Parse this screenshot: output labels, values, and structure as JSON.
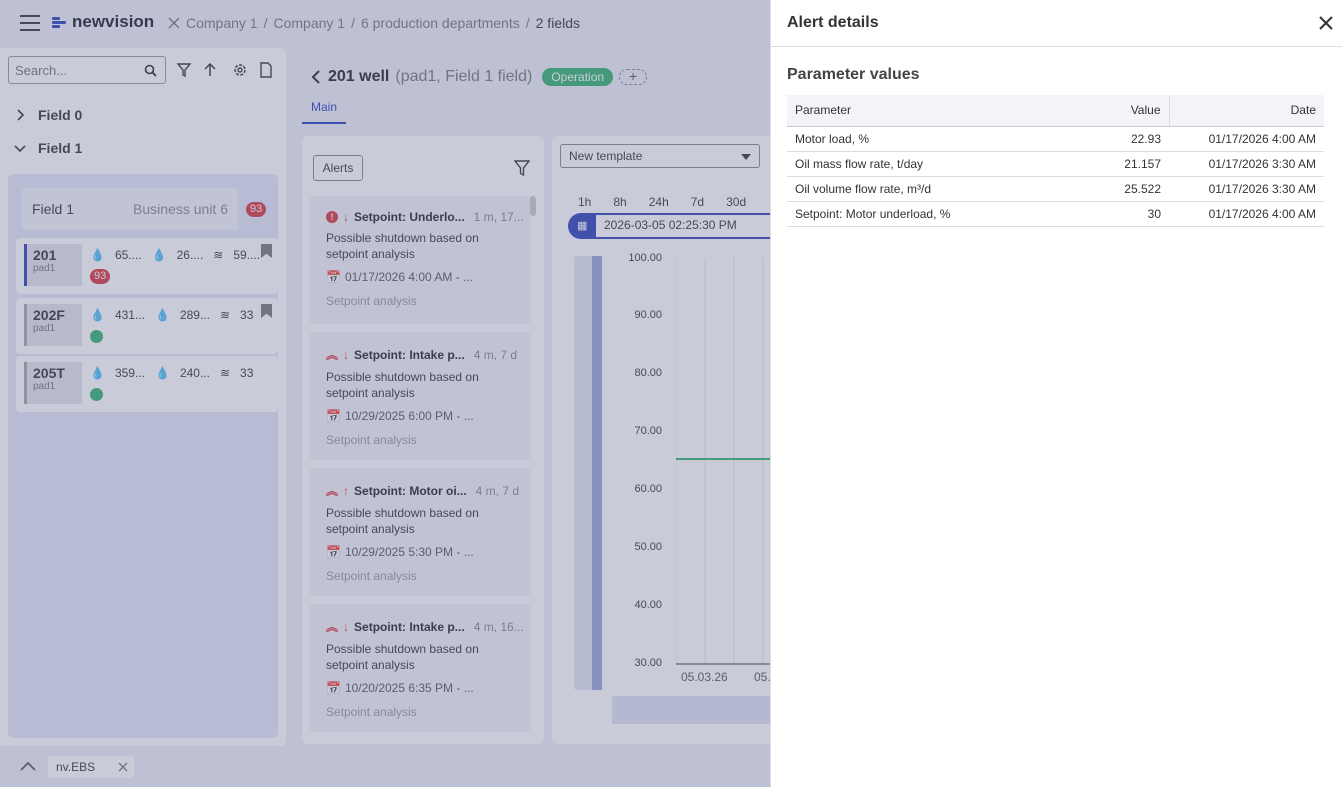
{
  "topbar": {
    "brand": "newvision",
    "breadcrumbs": [
      "Company 1",
      "/",
      "Company 1",
      "/",
      "6 production departments",
      "/",
      "2 fields"
    ]
  },
  "sidebar": {
    "search_placeholder": "Search...",
    "tree": [
      {
        "label": "Field 0",
        "expanded": false
      },
      {
        "label": "Field 1",
        "expanded": true
      }
    ],
    "field_card": {
      "name": "Field 1",
      "business_unit": "Business unit 6",
      "badge": "93"
    },
    "wells": [
      {
        "id": "201",
        "pad": "pad1",
        "v1": "65....",
        "v2": "26....",
        "v3": "59....",
        "badge": "93"
      },
      {
        "id": "202F",
        "pad": "pad1",
        "v1": "431...",
        "v2": "289...",
        "v3": "33"
      },
      {
        "id": "205T",
        "pad": "pad1",
        "v1": "359...",
        "v2": "240...",
        "v3": "33"
      }
    ]
  },
  "main": {
    "title": "201 well",
    "subtitle": "(pad1, Field 1 field)",
    "status": "Operation",
    "tab": "Main"
  },
  "alerts": {
    "button": "Alerts",
    "cards": [
      {
        "title": "Setpoint: Underlo...",
        "time": "1 m, 17...",
        "desc": "Possible shutdown based on setpoint analysis",
        "date": "01/17/2026 4:00 AM - ...",
        "source": "Setpoint analysis"
      },
      {
        "title": "Setpoint: Intake p...",
        "time": "4 m, 7 d",
        "desc": "Possible shutdown based on setpoint analysis",
        "date": "10/29/2025 6:00 PM - ...",
        "source": "Setpoint analysis"
      },
      {
        "title": "Setpoint: Motor oi...",
        "time": "4 m, 7 d",
        "desc": "Possible shutdown based on setpoint analysis",
        "date": "10/29/2025 5:30 PM - ...",
        "source": "Setpoint analysis"
      },
      {
        "title": "Setpoint: Intake p...",
        "time": "4 m, 16...",
        "desc": "Possible shutdown based on setpoint analysis",
        "date": "10/20/2025 6:35 PM - ...",
        "source": "Setpoint analysis"
      }
    ]
  },
  "chart": {
    "template": "New template",
    "ranges": [
      "1h",
      "8h",
      "24h",
      "7d",
      "30d"
    ],
    "date": "2026-03-05 02:25:30 PM",
    "y_ticks": [
      "100.00",
      "90.00",
      "80.00",
      "70.00",
      "60.00",
      "50.00",
      "40.00",
      "30.00"
    ],
    "x_ticks": [
      "05.03.26",
      "05."
    ]
  },
  "panel": {
    "title": "Alert details",
    "section": "Parameter values",
    "headers": [
      "Parameter",
      "Value",
      "Date"
    ],
    "rows": [
      {
        "parameter": "Motor load, %",
        "value": "22.93",
        "date": "01/17/2026 4:00 AM"
      },
      {
        "parameter": "Oil mass flow rate, t/day",
        "value": "21.157",
        "date": "01/17/2026 3:30 AM"
      },
      {
        "parameter": "Oil volume flow rate, m³/d",
        "value": "25.522",
        "date": "01/17/2026 3:30 AM"
      },
      {
        "parameter": "Setpoint: Motor underload, %",
        "value": "30",
        "date": "01/17/2026 4:00 AM"
      }
    ]
  },
  "bottom": {
    "tab": "nv.EBS"
  }
}
